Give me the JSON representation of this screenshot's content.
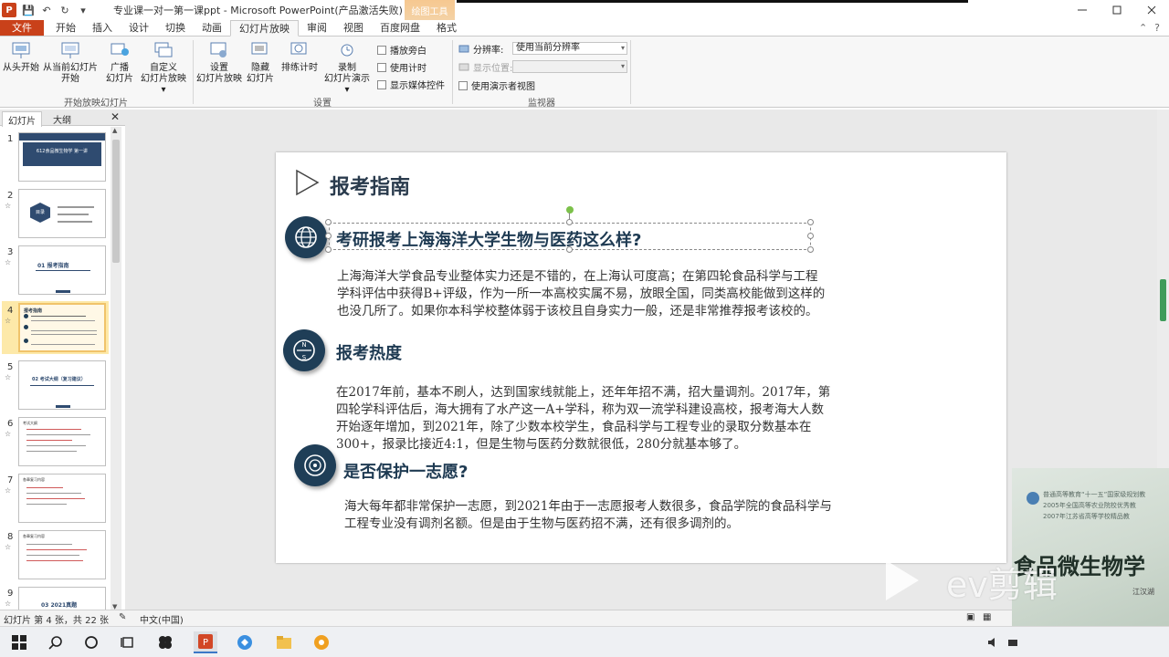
{
  "window": {
    "title": "专业课一对一第一课ppt - Microsoft PowerPoint(产品激活失败)",
    "context_group": "绘图工具",
    "controls": [
      "minimize",
      "maximize",
      "close"
    ]
  },
  "qat": {
    "app_icon": "P",
    "save": "💾",
    "undo": "↶",
    "redo": "↻",
    "customize": "▾"
  },
  "tabs": [
    {
      "label": "文件"
    },
    {
      "label": "开始"
    },
    {
      "label": "插入"
    },
    {
      "label": "设计"
    },
    {
      "label": "切换"
    },
    {
      "label": "动画"
    },
    {
      "label": "幻灯片放映"
    },
    {
      "label": "审阅"
    },
    {
      "label": "视图"
    },
    {
      "label": "百度网盘"
    },
    {
      "label": "格式"
    }
  ],
  "ribbon": {
    "group1": {
      "label": "开始放映幻灯片",
      "buttons": [
        {
          "label": "从头开始"
        },
        {
          "label": "从当前幻灯片",
          "label2": "开始"
        },
        {
          "label": "广播",
          "label2": "幻灯片"
        },
        {
          "label": "自定义",
          "label2": "幻灯片放映 ▾"
        }
      ]
    },
    "group2": {
      "label": "设置",
      "buttons": [
        {
          "label": "设置",
          "label2": "幻灯片放映"
        },
        {
          "label": "隐藏",
          "label2": "幻灯片"
        },
        {
          "label": "排练计时"
        },
        {
          "label": "录制",
          "label2": "幻灯片演示 ▾"
        }
      ],
      "checks": [
        "播放旁白",
        "使用计时",
        "显示媒体控件"
      ]
    },
    "group3": {
      "label": "监视器",
      "resolution_label": "分辨率:",
      "resolution_value": "使用当前分辨率",
      "display_label": "显示位置:",
      "presenter_view": "使用演示者视图"
    }
  },
  "pane": {
    "tab_slides": "幻灯片",
    "tab_outline": "大纲",
    "close": "✕",
    "thumbnails": [
      {
        "num": "1",
        "text": "612食品微生物学 第一讲"
      },
      {
        "num": "2",
        "text": "目录"
      },
      {
        "num": "3",
        "text": "01 报考指南"
      },
      {
        "num": "4",
        "text": "报考指南"
      },
      {
        "num": "5",
        "text": "02 考试大纲（复习建议）"
      },
      {
        "num": "6",
        "text": "考试大纲"
      },
      {
        "num": "7",
        "text": "各章复习内容"
      },
      {
        "num": "8",
        "text": "各章复习内容"
      },
      {
        "num": "9",
        "text": "03 2021真题"
      }
    ]
  },
  "slide": {
    "title": "报考指南",
    "sections": [
      {
        "heading": "考研报考上海海洋大学生物与医药这么样?",
        "lines": [
          "上海海洋大学食品专业整体实力还是不错的，在上海认可度高；在第四轮食品科学与工程",
          "学科评估中获得B+评级，作为一所一本高校实属不易，放眼全国，同类高校能做到这样的",
          "也没几所了。如果你本科学校整体弱于该校且自身实力一般，还是非常推荐报考该校的。"
        ]
      },
      {
        "heading": "报考热度",
        "lines": [
          "在2017年前，基本不刷人，达到国家线就能上，还年年招不满，招大量调剂。2017年，第",
          "四轮学科评估后，海大拥有了水产这一A+学科，称为双一流学科建设高校，报考海大人数",
          "开始逐年增加，到2021年，除了少数本校学生，食品科学与工程专业的录取分数基本在",
          "300+，报录比接近4:1，但是生物与医药分数就很低，280分就基本够了。"
        ]
      },
      {
        "heading": "是否保护一志愿?",
        "lines": [
          "海大每年都非常保护一志愿，到2021年由于一志愿报考人数很多，食品学院的食品科学与",
          "工程专业没有调剂名额。但是由于生物与医药招不满，还有很多调剂的。"
        ]
      }
    ]
  },
  "status": {
    "slide_info": "幻灯片 第 4 张，共 22 张",
    "language": "中文(中国)"
  },
  "overlay": {
    "book_line1": "普通高等教育“十一五”国家级规划教",
    "book_line2": "2005年全国高等农业院校优秀教",
    "book_line3": "2007年江苏省高等学校精品教",
    "book_title": "食品微生物学",
    "author": "江汉湖",
    "watermark": "ev剪辑"
  }
}
